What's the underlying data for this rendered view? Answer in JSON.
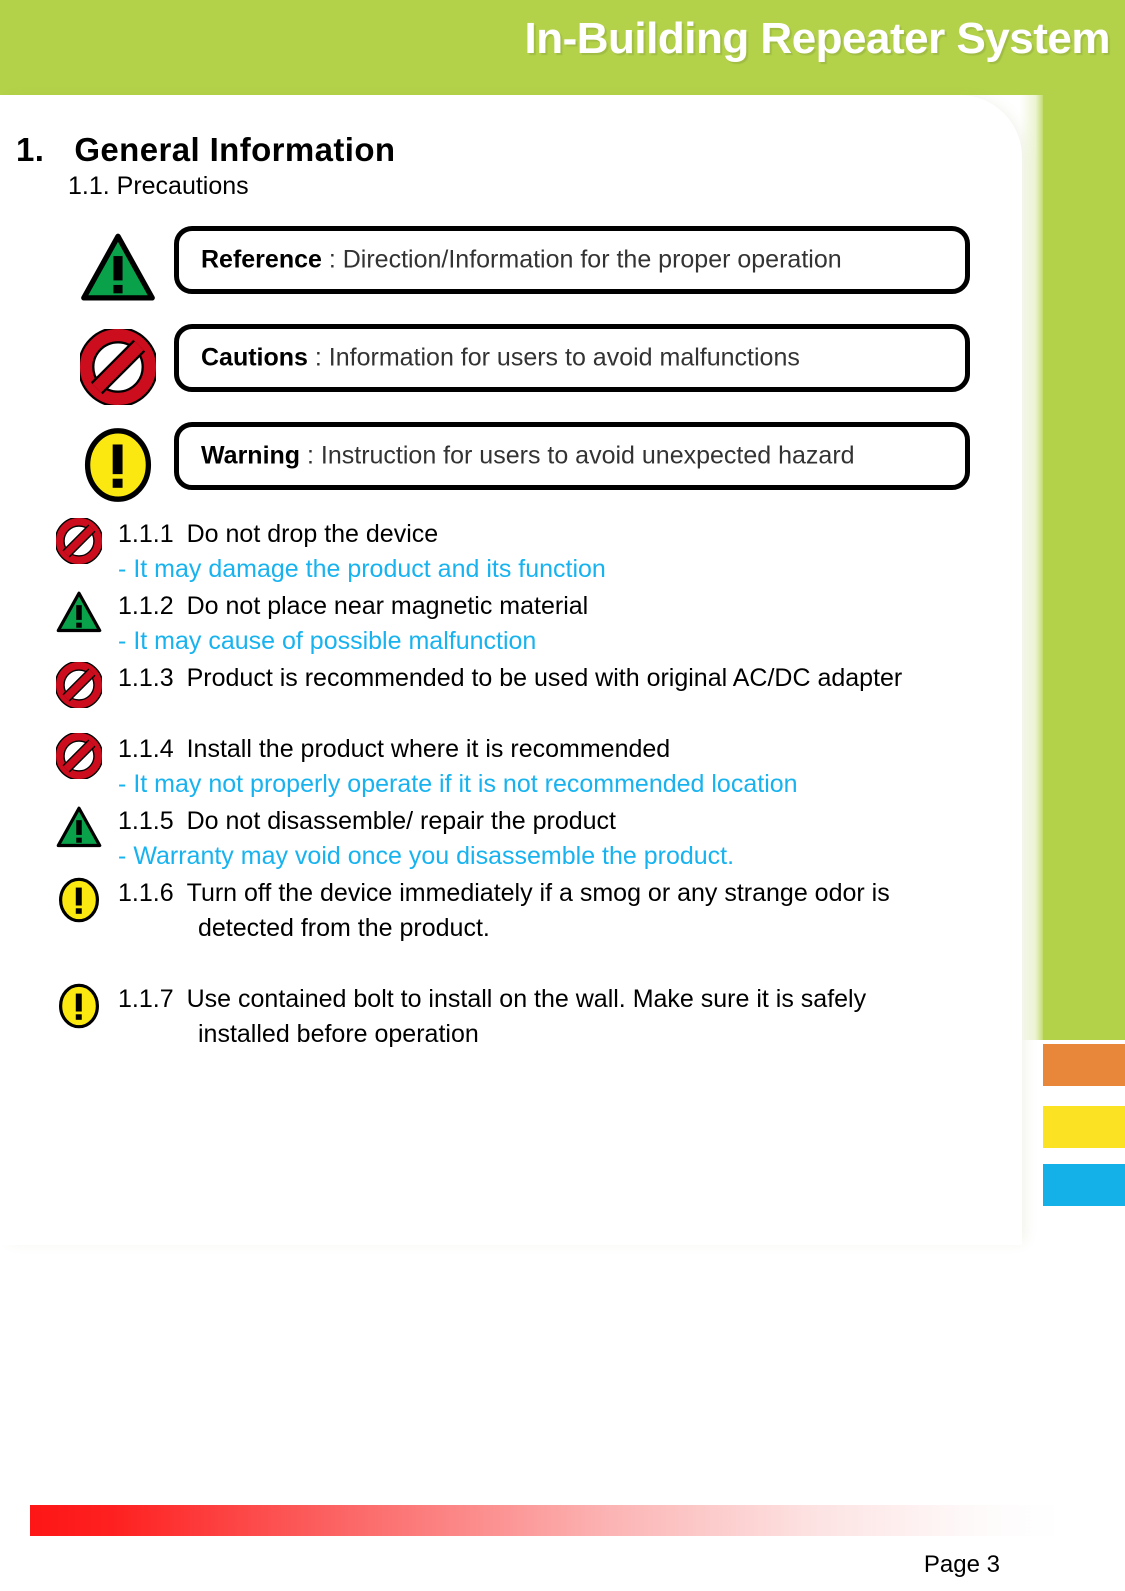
{
  "header": {
    "title": "In-Building Repeater System",
    "band_color": "#b3d249"
  },
  "section": {
    "number": "1.",
    "title": "General  Information",
    "subsection": "1.1. Precautions"
  },
  "legend": [
    {
      "icon": "green-triangle-exclamation-icon",
      "label": "Reference",
      "separator": " : ",
      "description": "Direction/Information for the proper operation"
    },
    {
      "icon": "red-prohibition-icon",
      "label": "Cautions",
      "separator": " : ",
      "description": "Information for users to avoid malfunctions"
    },
    {
      "icon": "yellow-circle-exclamation-icon",
      "label": "Warning",
      "separator": " : ",
      "description": "Instruction for users to avoid unexpected hazard"
    }
  ],
  "items": [
    {
      "icon": "red-prohibition-icon",
      "number": "1.1.1",
      "text": "Do not drop the device",
      "continuation": "",
      "note": "It may damage the product and its function",
      "note_dash": "-",
      "gap_after": false
    },
    {
      "icon": "green-triangle-exclamation-icon",
      "number": "1.1.2",
      "text": "Do not place near magnetic material",
      "continuation": "",
      "note": "It may cause of possible malfunction",
      "note_dash": "-",
      "gap_after": false
    },
    {
      "icon": "red-prohibition-icon",
      "number": "1.1.3",
      "text": "Product is recommended to be used with original AC/DC adapter",
      "continuation": "",
      "note": "",
      "note_dash": "-",
      "gap_after": true
    },
    {
      "icon": "red-prohibition-icon",
      "number": "1.1.4",
      "text": "Install the product where it is recommended",
      "continuation": "",
      "note": "It may not properly operate if it is not recommended location",
      "note_dash": "-",
      "gap_after": false
    },
    {
      "icon": "green-triangle-exclamation-icon",
      "number": "1.1.5",
      "text": "Do not disassemble/ repair the product",
      "continuation": "",
      "note": "Warranty may void once you disassemble the product.",
      "note_dash": "-",
      "gap_after": false
    },
    {
      "icon": "yellow-circle-exclamation-icon",
      "number": "1.1.6",
      "text": "Turn off the device immediately if a smog or any strange odor is",
      "continuation": "detected from the product.",
      "note": "",
      "note_dash": "-",
      "gap_after": true
    },
    {
      "icon": "yellow-circle-exclamation-icon",
      "number": "1.1.7",
      "text": "Use contained bolt to install on the wall.  Make sure it is safely",
      "continuation": "installed  before operation",
      "note": "",
      "note_dash": "-",
      "gap_after": false
    }
  ],
  "accents": {
    "orange": "#e8873a",
    "yellow": "#fbe223",
    "blue": "#14b0e8",
    "note_color": "#18b3ef",
    "footer_bar_color": "#fe1616"
  },
  "footer": {
    "page_label": "Page 3"
  }
}
